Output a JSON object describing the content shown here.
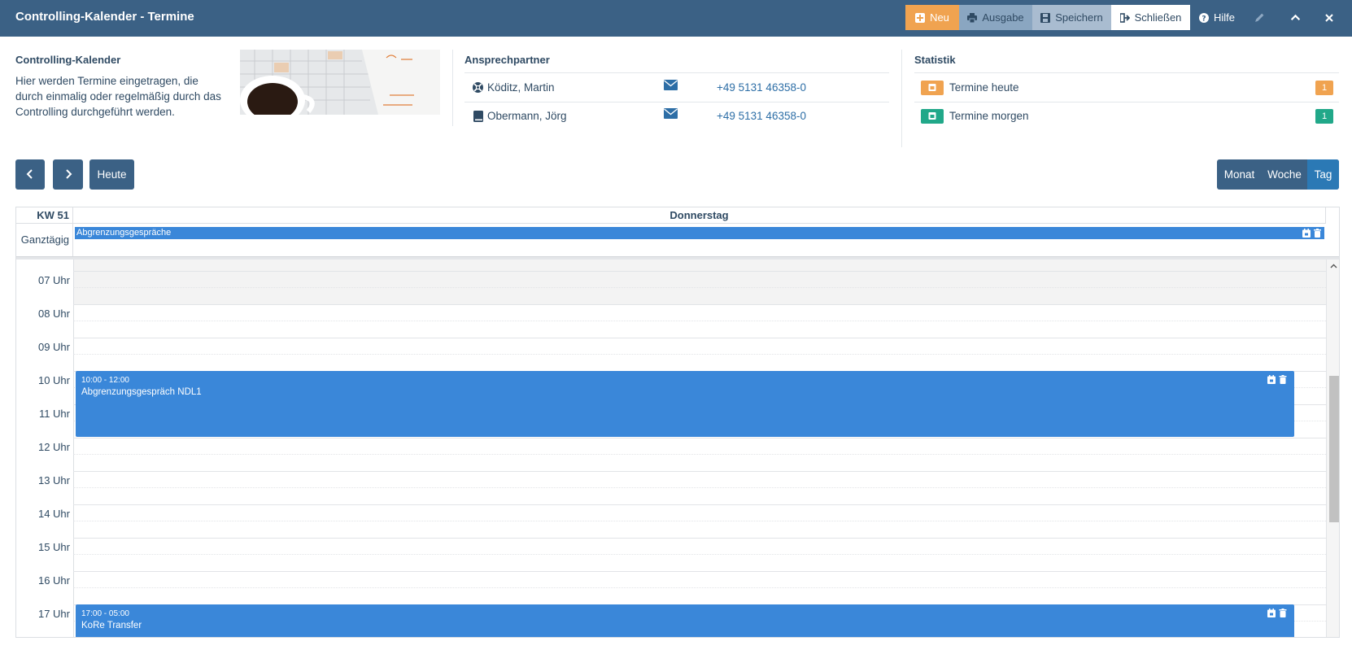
{
  "header": {
    "title": "Controlling-Kalender - Termine",
    "buttons": {
      "neu": "Neu",
      "ausgabe": "Ausgabe",
      "speichern": "Speichern",
      "schliessen": "Schließen",
      "hilfe": "Hilfe"
    }
  },
  "info": {
    "title": "Controlling-Kalender",
    "text": "Hier werden Termine eingetragen, die durch einmalig oder regelmäßig durch das Controlling durchgeführt werden."
  },
  "contacts": {
    "title": "Ansprechpartner",
    "items": [
      {
        "name": "Köditz, Martin",
        "phone": "+49 5131 46358-0"
      },
      {
        "name": "Obermann, Jörg",
        "phone": "+49 5131 46358-0"
      }
    ]
  },
  "stats": {
    "title": "Statistik",
    "items": [
      {
        "label": "Termine heute",
        "count": "1",
        "color": "#f0a350"
      },
      {
        "label": "Termine morgen",
        "count": "1",
        "color": "#21a889"
      }
    ]
  },
  "nav": {
    "prev": "‹",
    "next": "›",
    "today": "Heute",
    "views": {
      "month": "Monat",
      "week": "Woche",
      "day": "Tag"
    }
  },
  "calendar": {
    "week": "KW 51",
    "day": "Donnerstag",
    "allday_label": "Ganztägig",
    "allday_event": "Abgrenzungsgespräche",
    "hours": [
      "07 Uhr",
      "08 Uhr",
      "09 Uhr",
      "10 Uhr",
      "11 Uhr",
      "12 Uhr",
      "13 Uhr",
      "14 Uhr",
      "15 Uhr",
      "16 Uhr",
      "17 Uhr"
    ],
    "events": [
      {
        "time": "10:00 - 12:00",
        "title": "Abgrenzungsgespräch NDL1"
      },
      {
        "time": "17:00 - 05:00",
        "title": "KoRe Transfer"
      }
    ]
  },
  "colors": {
    "header": "#3b6185",
    "accent_orange": "#f0a350",
    "accent_green": "#21a889",
    "event_blue": "#3a87d9",
    "view_active": "#2b79b5"
  }
}
